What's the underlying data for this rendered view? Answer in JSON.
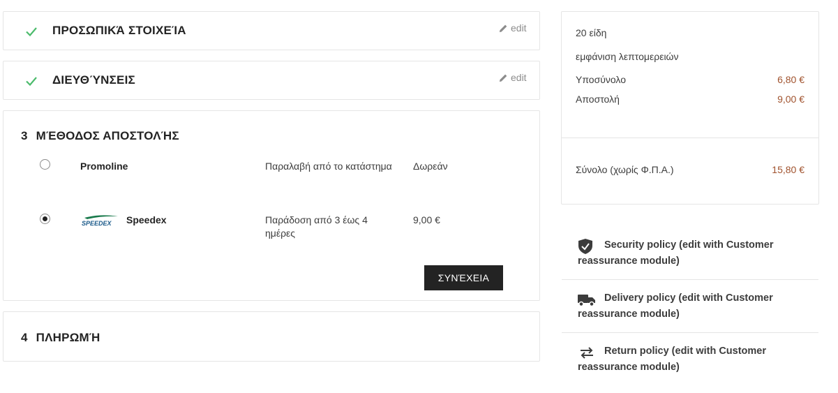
{
  "steps": {
    "personal": {
      "title": "ΠΡΟΣΩΠΙΚΆ ΣΤΟΙΧΕΊΑ",
      "edit": "edit"
    },
    "addresses": {
      "title": "ΔΙΕΥΘΎΝΣΕΙΣ",
      "edit": "edit"
    },
    "shipping": {
      "number": "3",
      "title": "ΜΈΘΟΔΟΣ ΑΠΟΣΤΟΛΉΣ",
      "carriers": [
        {
          "name": "Promoline",
          "delay": "Παραλαβή από το κατάστημα",
          "price": "Δωρεάν",
          "selected": false
        },
        {
          "name": "Speedex",
          "logo_text": "SPEEDEX",
          "delay": "Παράδοση από 3 έως 4 ημέρες",
          "price": "9,00 €",
          "selected": true
        }
      ],
      "continue_label": "ΣΥΝΈΧΕΙΑ"
    },
    "payment": {
      "number": "4",
      "title": "ΠΛΗΡΩΜΉ"
    }
  },
  "summary": {
    "items_count": "20 είδη",
    "show_details": "εμφάνιση λεπτομερειών",
    "subtotal_label": "Υποσύνολο",
    "subtotal_value": "6,80 €",
    "shipping_label": "Αποστολή",
    "shipping_value": "9,00 €",
    "total_label": "Σύνολο (χωρίς Φ.Π.Α.)",
    "total_value": "15,80 €"
  },
  "reassurance": [
    {
      "icon": "shield-check-icon",
      "text": "Security policy (edit with Customer reassurance module)"
    },
    {
      "icon": "truck-icon",
      "text": "Delivery policy (edit with Customer reassurance module)"
    },
    {
      "icon": "swap-arrows-icon",
      "text": "Return policy (edit with Customer reassurance module)"
    }
  ],
  "colors": {
    "check": "#4cbb6c",
    "price_accent": "#a0522d",
    "button_bg": "#232323",
    "speedex_green": "#1a7a4c"
  }
}
